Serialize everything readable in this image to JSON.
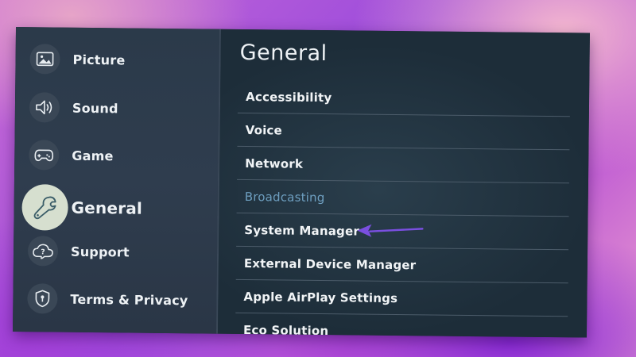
{
  "sidebar": {
    "items": [
      {
        "label": "Picture",
        "icon": "picture-icon"
      },
      {
        "label": "Sound",
        "icon": "speaker-icon"
      },
      {
        "label": "Game",
        "icon": "gamepad-icon"
      },
      {
        "label": "General",
        "icon": "wrench-icon"
      },
      {
        "label": "Support",
        "icon": "cloud-help-icon"
      },
      {
        "label": "Terms & Privacy",
        "icon": "shield-lock-icon"
      }
    ]
  },
  "main": {
    "title": "General",
    "items": [
      {
        "label": "Accessibility"
      },
      {
        "label": "Voice"
      },
      {
        "label": "Network"
      },
      {
        "label": "Broadcasting"
      },
      {
        "label": "System Manager"
      },
      {
        "label": "External Device Manager"
      },
      {
        "label": "Apple AirPlay Settings"
      },
      {
        "label": "Eco Solution"
      }
    ]
  },
  "colors": {
    "accent_arrow": "#7a4fe0",
    "dim_text": "#6e9fc0",
    "active_icon_bg": "#d6dfcf"
  }
}
